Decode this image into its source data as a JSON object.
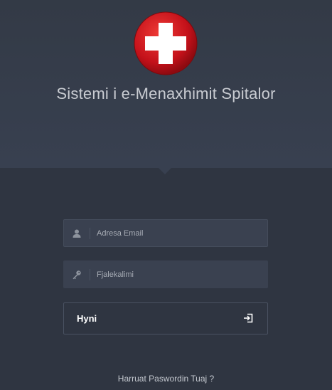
{
  "app": {
    "title": "Sistemi i e-Menaxhimit Spitalor"
  },
  "login": {
    "email_placeholder": "Adresa Email",
    "password_placeholder": "Fjalekalimi",
    "submit_label": "Hyni",
    "forgot_label": "Harruat Paswordin Tuaj ?"
  },
  "colors": {
    "logo_red": "#d0121a",
    "background": "#2f3541",
    "header": "#384050"
  },
  "icons": {
    "logo": "red-cross-icon",
    "email": "user-icon",
    "password": "key-icon",
    "submit": "sign-in-icon"
  }
}
